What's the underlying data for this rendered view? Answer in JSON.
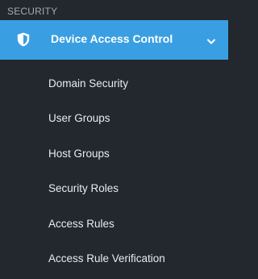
{
  "sidebar": {
    "section_label": "SECURITY",
    "group": {
      "icon": "shield-icon",
      "label": "Device Access Control",
      "expanded": true,
      "chevron_icon": "chevron-down-icon"
    },
    "items": [
      {
        "label": "Domain Security"
      },
      {
        "label": "User Groups"
      },
      {
        "label": "Host Groups"
      },
      {
        "label": "Security Roles"
      },
      {
        "label": "Access Rules"
      },
      {
        "label": "Access Rule Verification"
      }
    ]
  },
  "colors": {
    "sidebar_bg": "#22282d",
    "active_bg": "#3a9fe2",
    "text": "#e8ecef",
    "section_text": "#a4abb1"
  }
}
